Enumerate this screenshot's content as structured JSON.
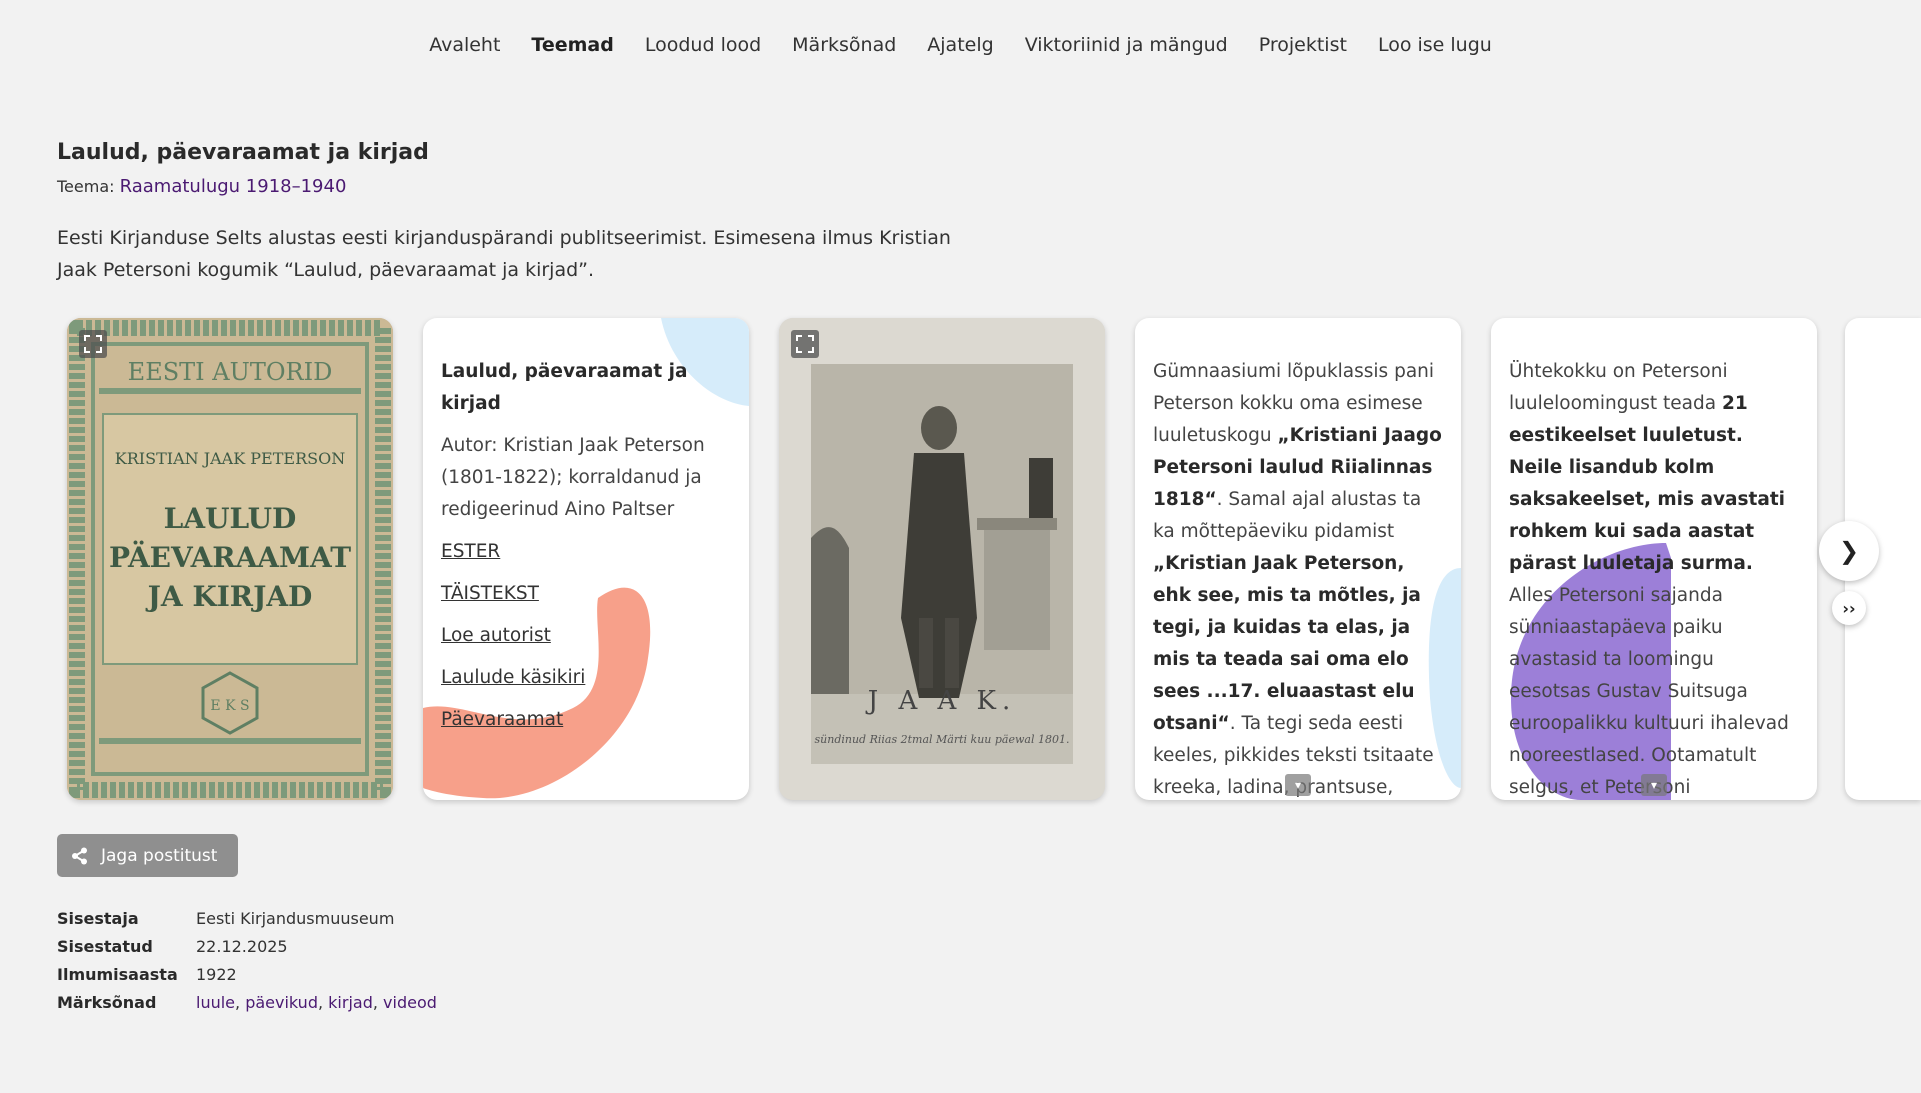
{
  "nav": {
    "items": [
      "Avaleht",
      "Teemad",
      "Loodud lood",
      "Märksõnad",
      "Ajatelg",
      "Viktoriinid ja mängud",
      "Projektist",
      "Loo ise lugu"
    ],
    "active": "Teemad"
  },
  "post": {
    "title": "Laulud, päevaraamat ja kirjad",
    "topic_label": "Teema:",
    "topic_link": "Raamatulugu 1918–1940",
    "intro": "Eesti Kirjanduse Selts alustas eesti kirjanduspärandi publitseerimist. Esimesena ilmus Kristian Jaak Petersoni kogumik “Laulud, päevaraamat ja kirjad”."
  },
  "cover": {
    "top": "EESTI AUTORID",
    "author": "KRISTIAN JAAK PETERSON",
    "title_line1": "LAULUD",
    "title_line2": "PÄEVARAAMAT",
    "title_line3": "JA KIRJAD",
    "logo": "E K S"
  },
  "portrait": {
    "caption": "J A A K.",
    "subcaption": "sündinud Riias 2tmal Märti kuu päewal 1801."
  },
  "card2": {
    "title": "Laulud, päevaraamat ja kirjad",
    "author": "Autor: Kristian Jaak Peterson (1801-1822); korraldanud ja redigeerinud Aino Paltser",
    "links": [
      "ESTER",
      "TÄISTEKST",
      "Loe autorist",
      "Laulude käsikiri",
      "Päevaraamat"
    ]
  },
  "card4": {
    "t1": "Gümnaasiumi lõpuklassis pani Peterson kokku oma esimese luuletuskogu ",
    "b1": "„Kristiani Jaago Petersoni laulud Riialinnas 1818“",
    "t2": ". Samal ajal alustas ta ka mõttepäeviku pidamist ",
    "b2": "„Kristian Jaak Peterson, ehk see, mis ta mõtles, ja tegi, ja kuidas ta elas, ja mis ta teada sai oma elo sees ...17. eluaastast elu otsani“",
    "t3": ". Ta tegi seda eesti keeles, pikkides teksti tsitaate kreeka, ladina, prantsuse, saksa, inglise, vene"
  },
  "card5": {
    "t1": "Ühtekokku on Petersoni luuleloomingust teada ",
    "b1": "21 eestikeelset luuletust. Neile lisandub kolm saksakeelset, mis avastati rohkem kui sada aastat pärast luuletaja surma.",
    "t2": " Alles Petersoni sajanda sünniaastapäeva paiku avastasid ta loomingu eesotsas Gustav Suitsuga euroopalikku kultuuri ihalevad nooreestlased. Ootamatult selgus, et Petersoni enneolematutes"
  },
  "carousel": {
    "next_icon": "❯",
    "last_icon": "››"
  },
  "share": {
    "label": "Jaga postitust"
  },
  "meta": {
    "entered_by_label": "Sisestaja",
    "entered_by": "Eesti Kirjandusmuuseum",
    "entered_label": "Sisestatud",
    "entered": "22.12.2025",
    "year_label": "Ilmumisaasta",
    "year": "1922",
    "keywords_label": "Märksõnad",
    "keywords": [
      "luule",
      "päevikud",
      "kirjad",
      "videod"
    ]
  },
  "colors": {
    "background": "#f2f2f2",
    "link_purple": "#4b1a72",
    "salmon": "#f7a08a",
    "light_blue": "#d6ecfa",
    "lavender": "#9c7fd8",
    "share_button": "#8f8f8f"
  }
}
